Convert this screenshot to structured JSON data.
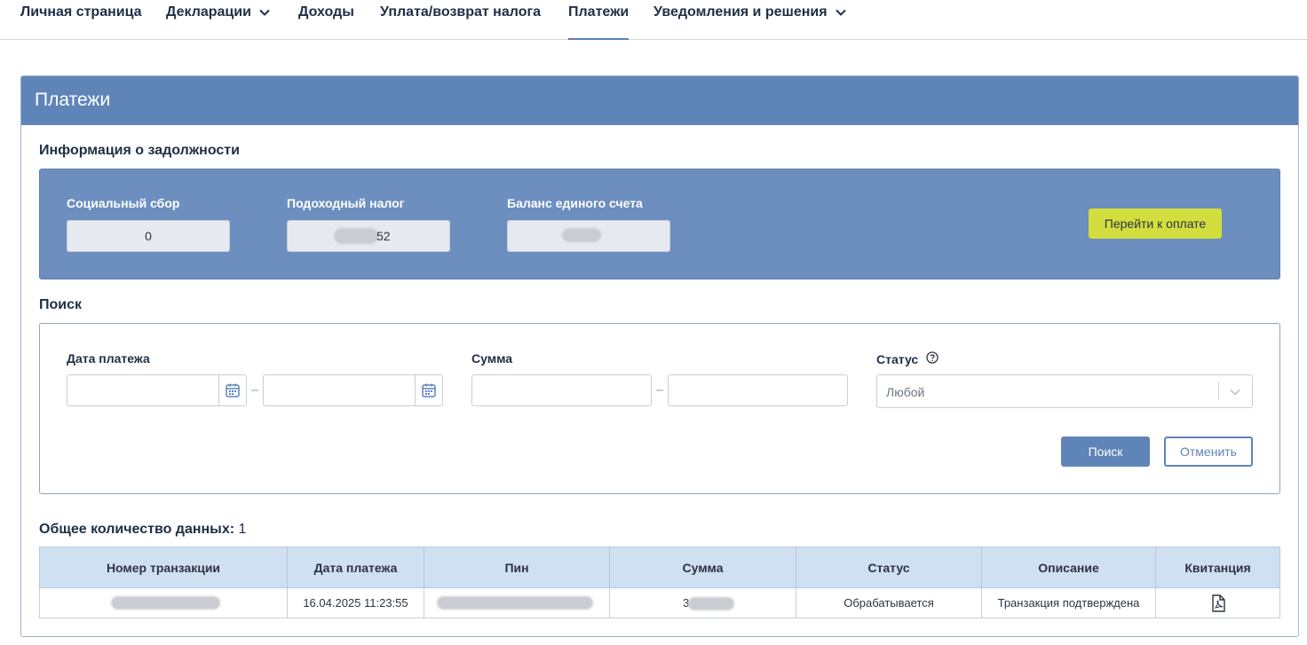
{
  "nav": {
    "items": [
      {
        "label": "Личная страница",
        "dropdown": false,
        "active": false
      },
      {
        "label": "Декларации",
        "dropdown": true,
        "active": false
      },
      {
        "label": "Доходы",
        "dropdown": false,
        "active": false
      },
      {
        "label": "Уплата/возврат налога",
        "dropdown": false,
        "active": false
      },
      {
        "label": "Платежи",
        "dropdown": false,
        "active": true
      },
      {
        "label": "Уведомления и решения",
        "dropdown": true,
        "active": false
      }
    ]
  },
  "page": {
    "title": "Платежи"
  },
  "debt": {
    "section_title": "Информация о задолжности",
    "social": {
      "label": "Социальный сбор",
      "value": "0"
    },
    "income_tax": {
      "label": "Подоходный налог",
      "value": "52"
    },
    "balance": {
      "label": "Баланс единого счета",
      "value": ""
    },
    "pay_button": "Перейти к оплате"
  },
  "search": {
    "section_title": "Поиск",
    "date_label": "Дата платежа",
    "date_from": "",
    "date_to": "",
    "amount_label": "Сумма",
    "amount_from": "",
    "amount_to": "",
    "status_label": "Статус",
    "status_value": "Любой",
    "search_button": "Поиск",
    "cancel_button": "Отменить"
  },
  "results": {
    "total_label": "Общее количество данных:",
    "total_value": "1",
    "columns": [
      "Номер транзакции",
      "Дата платежа",
      "Пин",
      "Сумма",
      "Статус",
      "Описание",
      "Квитанция"
    ],
    "rows": [
      {
        "transaction": "",
        "date": "16.04.2025 11:23:55",
        "pin": "",
        "amount": "3",
        "status": "Обрабатывается",
        "description": "Транзакция подтверждена",
        "receipt_icon": "pdf-file-icon"
      }
    ]
  },
  "colors": {
    "accent": "#5f84b8",
    "panel": "#6d8fc0",
    "pay_button": "#d2de3e",
    "table_header": "#cfe0f1"
  }
}
